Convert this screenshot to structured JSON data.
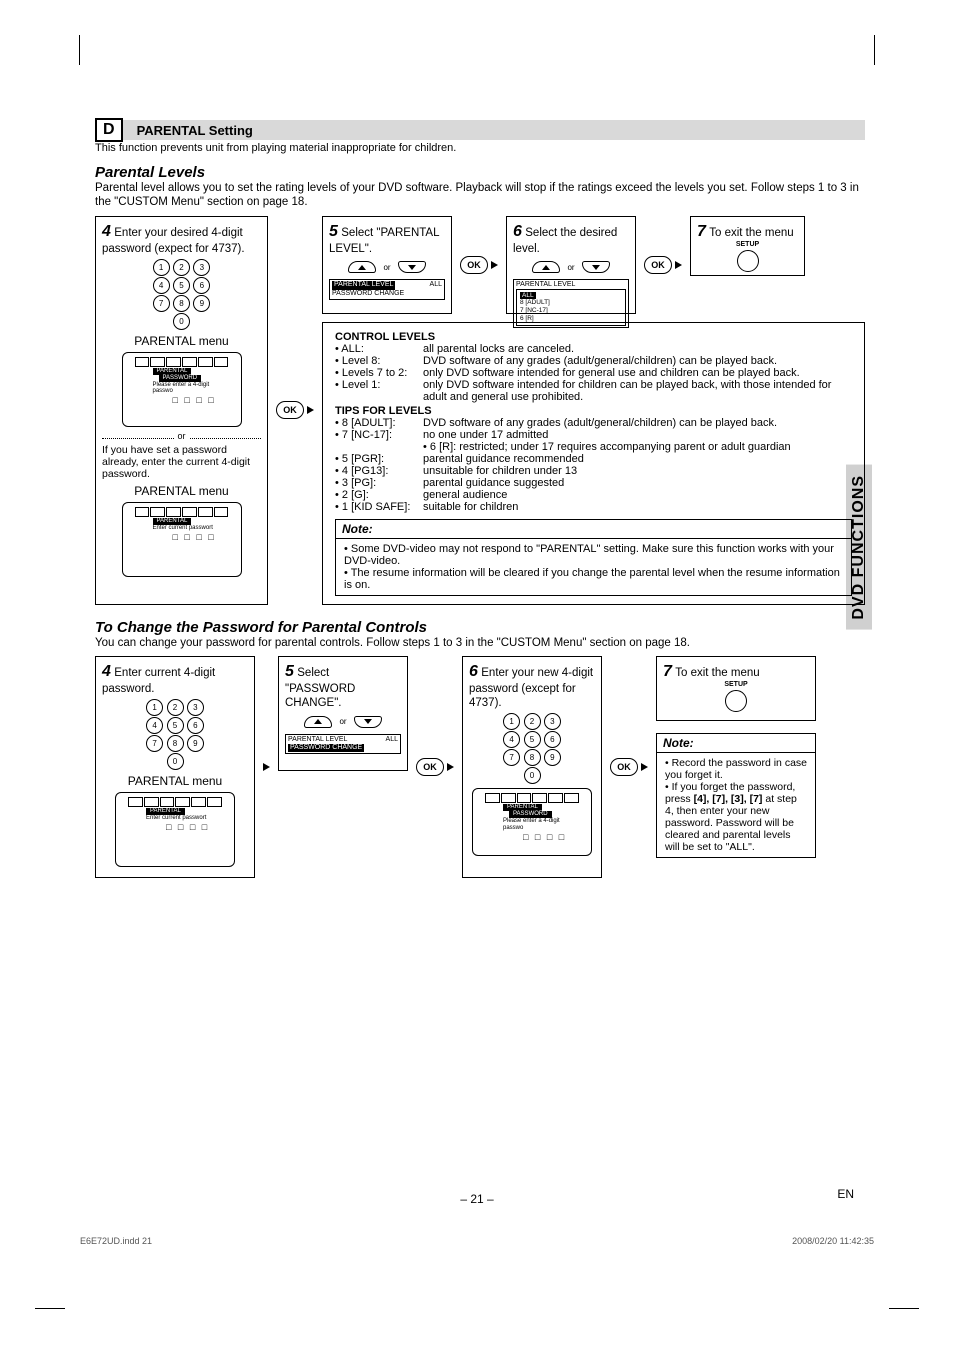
{
  "sideTab": "DVD FUNCTIONS",
  "sectionLetter": "D",
  "sectionTitle": "PARENTAL Setting",
  "sectionDesc": "This function prevents unit from playing material inappropriate for children.",
  "h_levels": "Parental Levels",
  "p_levels": "Parental level allows you to set the rating levels of your DVD software. Playback will stop if the ratings exceed the levels you set. Follow steps 1 to 3 in the \"CUSTOM Menu\" section on page 18.",
  "step4a_title": "Enter your desired 4-digit password (expect for 4737).",
  "nums": {
    "r1": [
      "1",
      "2",
      "3"
    ],
    "r2": [
      "4",
      "5",
      "6"
    ],
    "r3": [
      "7",
      "8",
      "9"
    ],
    "r4": [
      "0"
    ]
  },
  "menu_label": "PARENTAL menu",
  "tv1": {
    "tab": "PARENTAL",
    "sub": "PASSWORD",
    "hint": "Please enter a 4-digit passwo",
    "boxes": "□ □ □ □"
  },
  "or": "or",
  "if_pw": "If you have set a password already, enter the current 4-digit password.",
  "tv2": {
    "tab": "PARENTAL",
    "hint": "Enter current passwort",
    "boxes": "□ □ □ □"
  },
  "ok": "OK",
  "step5a_title": "Select \"PARENTAL LEVEL\".",
  "mini5a": {
    "l1": "PARENTAL LEVEL",
    "r1": "ALL",
    "l2": "PASSWORD CHANGE"
  },
  "step6a_title": "Select the desired level.",
  "mini6a": {
    "l1": "PARENTAL LEVEL",
    "opts": [
      "ALL",
      "8 [ADULT]",
      "7 [NC-17]",
      "6 [R]"
    ]
  },
  "step7a_title": "To exit the menu",
  "setup": "SETUP",
  "ctrl_head": "CONTROL LEVELS",
  "ctrl": [
    {
      "k": "• ALL:",
      "v": "all parental locks are canceled."
    },
    {
      "k": "• Level 8:",
      "v": "DVD software of any grades (adult/general/children) can be played back."
    },
    {
      "k": "• Levels 7 to 2:",
      "v": "only DVD software intended for general use and children can be played back."
    },
    {
      "k": "• Level 1:",
      "v": "only DVD software intended for children can be played back, with those intended for adult and general use prohibited."
    }
  ],
  "tips_head": "TIPS FOR LEVELS",
  "tips": [
    {
      "k": "• 8 [ADULT]:",
      "v": "DVD software of any grades (adult/general/children) can be played back."
    },
    {
      "k": "• 7 [NC-17]:",
      "v": "no one under 17 admitted"
    },
    {
      "k": "",
      "v": "• 6 [R]: restricted; under 17 requires accompanying parent or adult guardian"
    },
    {
      "k": "• 5 [PGR]:",
      "v": "parental guidance recommended"
    },
    {
      "k": "• 4 [PG13]:",
      "v": "unsuitable for children under 13"
    },
    {
      "k": "• 3 [PG]:",
      "v": "parental guidance suggested"
    },
    {
      "k": "• 2 [G]:",
      "v": "general audience"
    },
    {
      "k": "• 1 [KID SAFE]:",
      "v": "suitable for children"
    }
  ],
  "note_head": "Note:",
  "note1": [
    "• Some DVD-video may not respond to \"PARENTAL\" setting. Make sure this function works with your DVD-video.",
    "• The resume information will be cleared if you change the parental level when the resume information is on."
  ],
  "h_change": "To Change the Password for Parental Controls",
  "p_change": "You can change your password for parental controls.  Follow steps 1 to 3 in the \"CUSTOM Menu\" section on page 18.",
  "step4b_title": "Enter current 4-digit password.",
  "tv3": {
    "tab": "PARENTAL",
    "hint": "Enter current passwort",
    "boxes": "□ □ □ □"
  },
  "step5b_title": "Select \"PASSWORD CHANGE\".",
  "mini5b": {
    "l1": "PARENTAL LEVEL",
    "r1": "ALL",
    "l2": "PASSWORD CHANGE"
  },
  "step6b_title": "Enter your new 4-digit password (except for 4737).",
  "tv4": {
    "tab": "PARENTAL",
    "sub": "PASSWORD",
    "hint": "Please enter a 4-digit passwo",
    "boxes": "□ □ □ □"
  },
  "step7b_title": "To exit the menu",
  "note2_head": "Note:",
  "note2": [
    "• Record the password in case you forget it.",
    "• If you forget the password, press [4], [7], [3], [7] at step 4, then enter your new password. Password will be cleared and parental levels will be set to \"ALL\"."
  ],
  "note2_bold": "[4], [7], [3], [7]",
  "pageNum": "– 21 –",
  "en": "EN",
  "footerL": "E6E72UD.indd   21",
  "footerR": "2008/02/20   11:42:35"
}
